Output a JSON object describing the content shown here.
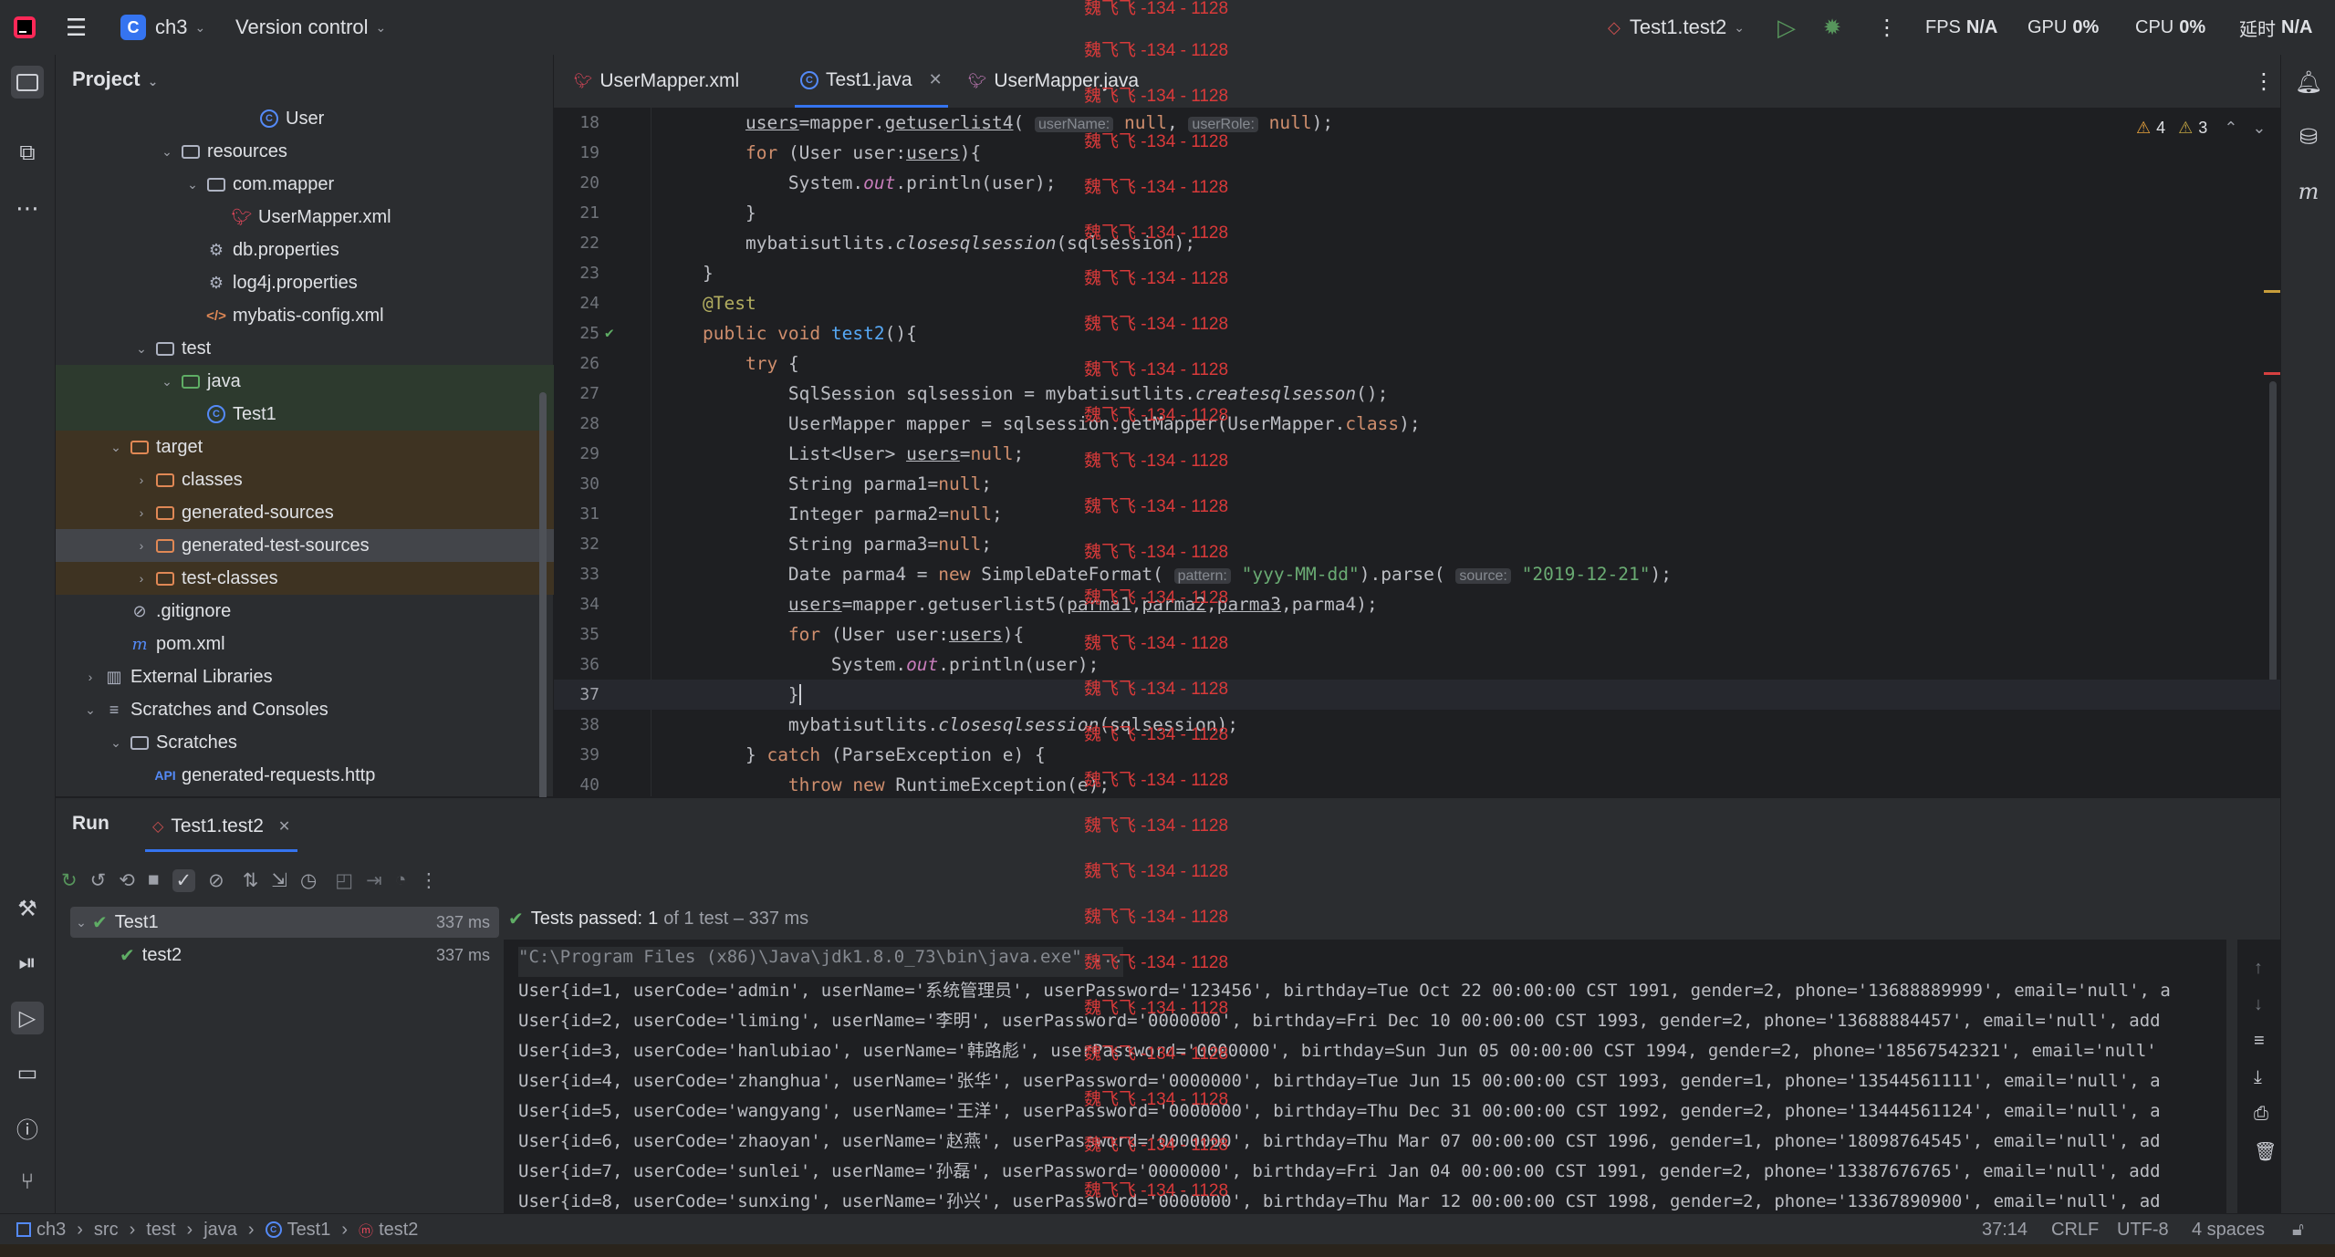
{
  "titlebar": {
    "project_initial": "C",
    "project_name": "ch3",
    "vcs_label": "Version control",
    "run_config": "Test1.test2",
    "perf": [
      {
        "label": "FPS",
        "value": "N/A"
      },
      {
        "label": "GPU",
        "value": "0%"
      },
      {
        "label": "CPU",
        "value": "0%"
      },
      {
        "label": "延时",
        "value": "N/A"
      }
    ]
  },
  "project_panel": {
    "title": "Project",
    "items": [
      {
        "label": "User",
        "icon": "class-icon"
      },
      {
        "label": "resources",
        "icon": "folder-icon"
      },
      {
        "label": "com.mapper",
        "icon": "folder-icon"
      },
      {
        "label": "UserMapper.xml",
        "icon": "mybatis-xml-icon"
      },
      {
        "label": "db.properties",
        "icon": "settings-file-icon"
      },
      {
        "label": "log4j.properties",
        "icon": "settings-file-icon"
      },
      {
        "label": "mybatis-config.xml",
        "icon": "xml-icon"
      },
      {
        "label": "test",
        "icon": "folder-icon"
      },
      {
        "label": "java",
        "icon": "test-folder-icon"
      },
      {
        "label": "Test1",
        "icon": "class-icon"
      },
      {
        "label": "target",
        "icon": "excluded-folder-icon"
      },
      {
        "label": "classes",
        "icon": "folder-icon"
      },
      {
        "label": "generated-sources",
        "icon": "folder-icon"
      },
      {
        "label": "generated-test-sources",
        "icon": "folder-icon"
      },
      {
        "label": "test-classes",
        "icon": "folder-icon"
      },
      {
        "label": ".gitignore",
        "icon": "ignore-icon"
      },
      {
        "label": "pom.xml",
        "icon": "maven-icon"
      },
      {
        "label": "External Libraries",
        "icon": "library-icon"
      },
      {
        "label": "Scratches and Consoles",
        "icon": "scratches-icon"
      },
      {
        "label": "Scratches",
        "icon": "folder-icon"
      },
      {
        "label": "generated-requests.http",
        "icon": "http-file-icon"
      }
    ]
  },
  "editor": {
    "tabs": [
      {
        "label": "UserMapper.xml"
      },
      {
        "label": "Test1.java"
      },
      {
        "label": "UserMapper.java"
      }
    ],
    "warnings": "4",
    "weak_warnings": "3",
    "line_numbers": [
      "18",
      "19",
      "20",
      "21",
      "22",
      "23",
      "24",
      "25",
      "26",
      "27",
      "28",
      "29",
      "30",
      "31",
      "32",
      "33",
      "34",
      "35",
      "36",
      "37",
      "38",
      "39",
      "40"
    ]
  },
  "run_panel": {
    "title": "Run",
    "tab": "Test1.test2",
    "tests_passed_label": "Tests passed:",
    "tests_passed_count": "1",
    "tests_passed_detail": "of 1 test – 337 ms",
    "tree": [
      {
        "label": "Test1",
        "time": "337 ms"
      },
      {
        "label": "test2",
        "time": "337 ms"
      }
    ],
    "console": [
      "\"C:\\Program Files (x86)\\Java\\jdk1.8.0_73\\bin\\java.exe\" ...",
      "User{id=1, userCode='admin', userName='系统管理员', userPassword='123456', birthday=Tue Oct 22 00:00:00 CST 1991, gender=2, phone='13688889999', email='null', a",
      "User{id=2, userCode='liming', userName='李明', userPassword='0000000', birthday=Fri Dec 10 00:00:00 CST 1993, gender=2, phone='13688884457', email='null', add",
      "User{id=3, userCode='hanlubiao', userName='韩路彪', userPassword='0000000', birthday=Sun Jun 05 00:00:00 CST 1994, gender=2, phone='18567542321', email='null'",
      "User{id=4, userCode='zhanghua', userName='张华', userPassword='0000000', birthday=Tue Jun 15 00:00:00 CST 1993, gender=1, phone='13544561111', email='null', a",
      "User{id=5, userCode='wangyang', userName='王洋', userPassword='0000000', birthday=Thu Dec 31 00:00:00 CST 1992, gender=2, phone='13444561124', email='null', a",
      "User{id=6, userCode='zhaoyan', userName='赵燕', userPassword='0000000', birthday=Thu Mar 07 00:00:00 CST 1996, gender=1, phone='18098764545', email='null', ad",
      "User{id=7, userCode='sunlei', userName='孙磊', userPassword='0000000', birthday=Fri Jan 04 00:00:00 CST 1991, gender=2, phone='13387676765', email='null', add",
      "User{id=8, userCode='sunxing', userName='孙兴', userPassword='0000000', birthday=Thu Mar 12 00:00:00 CST 1998, gender=2, phone='13367890900', email='null', ad"
    ]
  },
  "statusbar": {
    "breadcrumbs": [
      "ch3",
      "src",
      "test",
      "java",
      "Test1",
      "test2"
    ],
    "position": "37:14",
    "line_ending": "CRLF",
    "encoding": "UTF-8",
    "indent": "4 spaces"
  },
  "watermark": "魏飞飞 -134 - 1128"
}
